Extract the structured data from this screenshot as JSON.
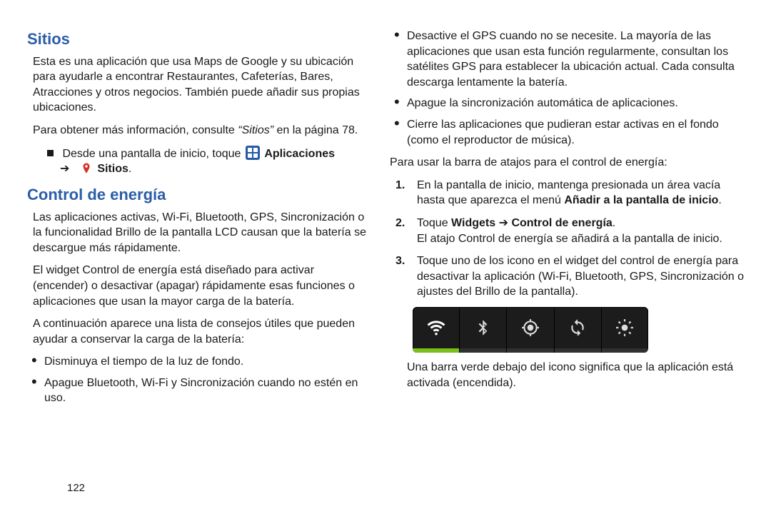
{
  "page_number": "122",
  "left": {
    "h_sitios": "Sitios",
    "p_sitios_desc": "Esta es una aplicación que usa Maps de Google y su ubicación para ayudarle a encontrar Restaurantes, Cafeterías, Bares, Atracciones y otros negocios. También puede añadir sus propias ubicaciones.",
    "p_sitios_ref_a": "Para obtener más información, consulte ",
    "p_sitios_ref_quote": "“Sitios”",
    "p_sitios_ref_b": " en la página 78.",
    "step_prefix": "Desde una pantalla de inicio, toque ",
    "apps_label": "Aplicaciones",
    "arrow": "➔",
    "sitios_label": "Sitios",
    "h_control": "Control de energía",
    "p_control_1": "Las aplicaciones activas, Wi-Fi, Bluetooth, GPS, Sincronización o la funcionalidad Brillo de la pantalla LCD causan que la batería se descargue más rápidamente.",
    "p_control_2": "El widget Control de energía está diseñado para activar (encender) o desactivar (apagar) rápidamente esas funciones o aplicaciones que usan la mayor carga de la batería.",
    "p_control_3": "A continuación aparece una lista de consejos útiles que pueden ayudar a conservar la carga de la batería:",
    "bul1": "Disminuya el tiempo de la luz de fondo.",
    "bul2": "Apague Bluetooth, Wi-Fi y Sincronización cuando no estén en uso."
  },
  "right": {
    "bul3": "Desactive el GPS cuando no se necesite. La mayoría de las aplicaciones que usan esta función regularmente, consultan los satélites GPS para establecer la ubicación actual. Cada consulta descarga lentamente la batería.",
    "bul4": "Apague la sincronización automática de aplicaciones.",
    "bul5": "Cierre las aplicaciones que pudieran estar activas en el fondo (como el reproductor de música).",
    "p_shortcut": "Para usar la barra de atajos para el control de energía:",
    "n1a": "En la pantalla de inicio, mantenga presionada un área vacía hasta que aparezca el menú ",
    "n1b": "Añadir a la pantalla de inicio",
    "n2a": "Toque ",
    "n2b": "Widgets",
    "n2_arrow": "➔",
    "n2c": "Control de energía",
    "n2_tail": "El atajo Control de energía se añadirá a la pantalla de inicio.",
    "n3": "Toque uno de los icono en el widget del control de energía para desactivar la aplicación (Wi-Fi, Bluetooth, GPS, Sincronización o ajustes del Brillo de la pantalla).",
    "p_after_widget": "Una barra verde debajo del icono significa que la aplicación está activada (encendida)."
  },
  "widget": {
    "items": [
      {
        "name": "wifi-icon",
        "on": true
      },
      {
        "name": "bluetooth-icon",
        "on": false
      },
      {
        "name": "gps-icon",
        "on": false
      },
      {
        "name": "sync-icon",
        "on": false
      },
      {
        "name": "brightness-icon",
        "on": false
      }
    ]
  }
}
